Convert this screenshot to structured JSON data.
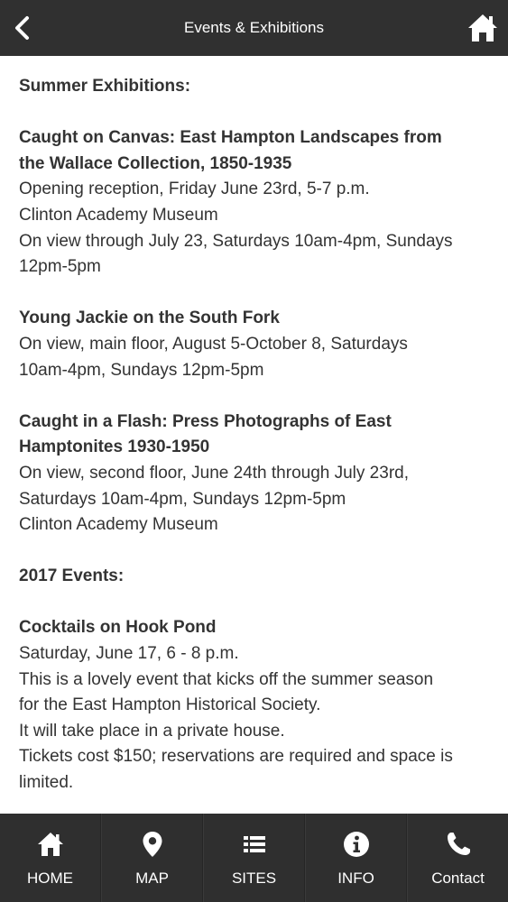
{
  "header": {
    "title": "Events & Exhibitions",
    "back_icon": "chevron-left-icon",
    "home_icon": "home-icon"
  },
  "content": {
    "summer_heading": "Summer Exhibitions:",
    "exhibit1": {
      "title_l1": "Caught on Canvas: East Hampton Landscapes from",
      "title_l2": "the Wallace Collection, 1850-1935",
      "l1": "Opening reception, Friday June 23rd, 5-7 p.m.",
      "l2": "Clinton Academy Museum",
      "l3": "On view through July 23, Saturdays 10am-4pm, Sundays",
      "l4": "12pm-5pm"
    },
    "exhibit2": {
      "title": "Young Jackie on the South Fork",
      "l1": "On view, main floor, August 5-October 8, Saturdays",
      "l2": "10am-4pm, Sundays 12pm-5pm"
    },
    "exhibit3": {
      "title_l1": "Caught in a Flash: Press Photographs of East",
      "title_l2": "Hamptonites 1930-1950",
      "l1": "On view, second floor, June 24th through July 23rd,",
      "l2": "Saturdays 10am-4pm, Sundays 12pm-5pm",
      "l3": "Clinton Academy Museum"
    },
    "events_heading": "2017 Events:",
    "event1": {
      "title": "Cocktails on Hook Pond",
      "l1": "Saturday, June 17, 6 - 8 p.m.",
      "l2": "This is a lovely event that kicks off the summer season",
      "l3": "for the East Hampton Historical Society.",
      "l4": "It will take place in a private house.",
      "l5": "Tickets cost $150; reservations are required and space is",
      "l6": "limited."
    }
  },
  "tabbar": {
    "items": [
      {
        "label": "HOME",
        "icon": "home-icon"
      },
      {
        "label": "MAP",
        "icon": "map-pin-icon"
      },
      {
        "label": "SITES",
        "icon": "list-icon"
      },
      {
        "label": "INFO",
        "icon": "info-icon"
      },
      {
        "label": "Contact",
        "icon": "phone-icon"
      }
    ]
  },
  "colors": {
    "bar_bg": "#303030",
    "text": "#333333",
    "background": "#ffffff"
  }
}
